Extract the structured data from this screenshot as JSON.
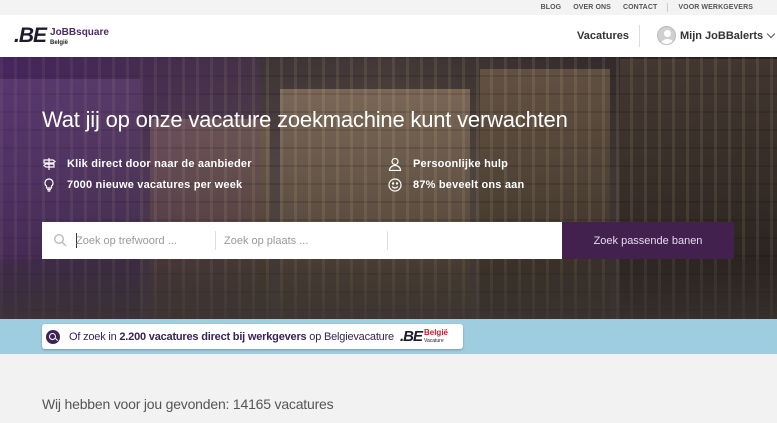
{
  "topbar": {
    "links": [
      "BLOG",
      "OVER ONS",
      "CONTACT",
      "VOOR WERKGEVERS"
    ]
  },
  "header": {
    "logo_mark": ".BE",
    "logo_name": "JoBBsquare",
    "logo_country": "België",
    "nav_vacatures": "Vacatures",
    "account_label": "Mijn JoBBalerts"
  },
  "hero": {
    "title": "Wat jij op onze vacature zoekmachine kunt verwachten",
    "features": [
      {
        "icon": "signpost-icon",
        "text": "Klik direct door naar de aanbieder"
      },
      {
        "icon": "person-icon",
        "text": "Persoonlijke hulp"
      },
      {
        "icon": "lightbulb-icon",
        "text": "7000 nieuwe vacatures per week"
      },
      {
        "icon": "smiley-icon",
        "text": "87% beveelt ons aan"
      }
    ]
  },
  "search": {
    "keyword_placeholder": "Zoek op trefwoord ...",
    "place_placeholder": "Zoek op plaats ...",
    "button_label": "Zoek passende banen"
  },
  "banner": {
    "text_prefix": "Of zoek in ",
    "text_bold": "2.200 vacatures direct bij werkgevers",
    "text_suffix": " op Belgievacature",
    "logo_mark": ".BE",
    "logo_name": "België",
    "logo_sub": "Vacature"
  },
  "results": {
    "heading": "Wij hebben voor jou gevonden: 14165 vacatures"
  }
}
